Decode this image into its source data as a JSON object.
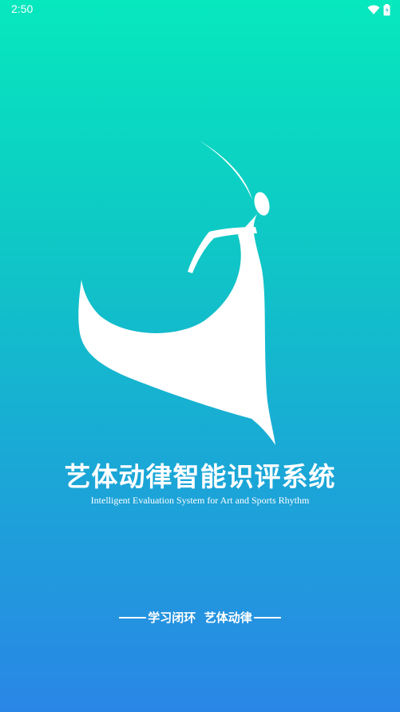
{
  "status_bar": {
    "time": "2:50",
    "icons": [
      "wifi-icon",
      "battery-icon"
    ]
  },
  "splash": {
    "logo": "dancer-logo",
    "title": "艺体动律智能识评系统",
    "subtitle": "Intelligent Evaluation System for Art and Sports Rhythm",
    "slogan": "学习闭环  艺体动律"
  },
  "colors": {
    "gradient_top": "#06e8bd",
    "gradient_bottom": "#2a86e6",
    "foreground": "#ffffff"
  }
}
